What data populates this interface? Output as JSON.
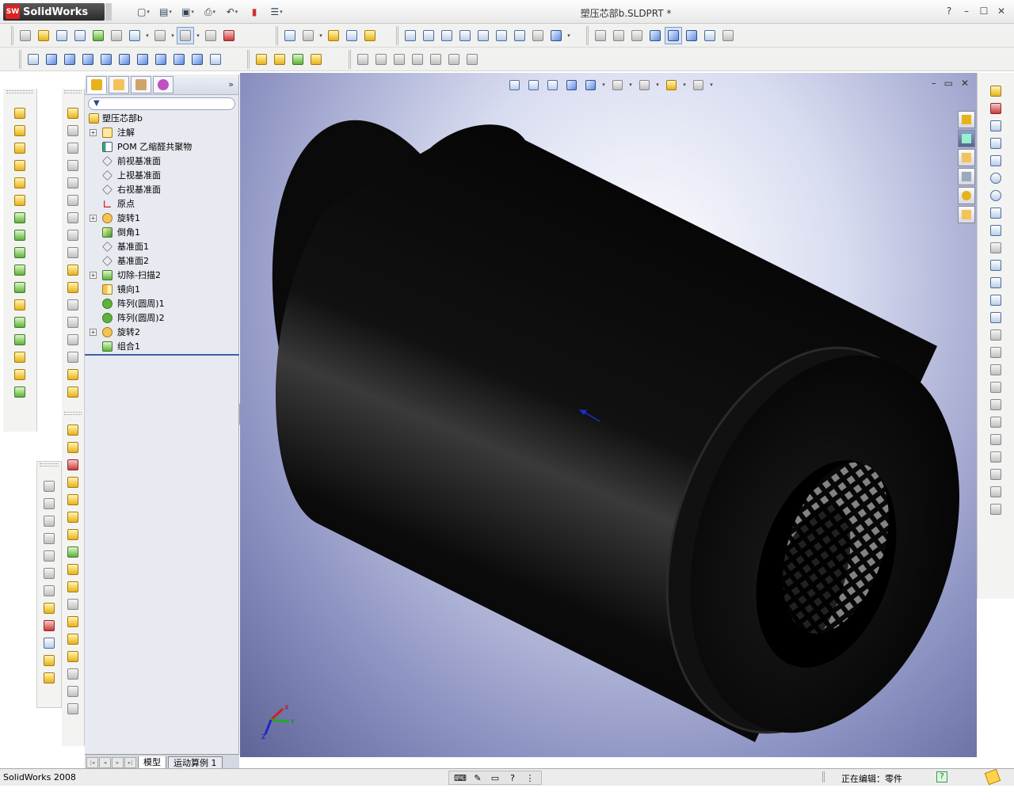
{
  "app": {
    "brand": "SolidWorks",
    "brand_badge": "SW",
    "document_title": "塑压芯部b.SLDPRT *",
    "window_controls": {
      "help": "?",
      "minimize": "–",
      "restore": "☐",
      "close": "✕"
    }
  },
  "feature_tree": {
    "filter_icon": "filter-icon",
    "expand_more": "»",
    "items": [
      {
        "label": "塑压芯部b",
        "icon": "part-icon",
        "expandable": false,
        "root": true
      },
      {
        "label": "注解",
        "icon": "annotations-icon",
        "expandable": true
      },
      {
        "label": "POM 乙缩醛共聚物",
        "icon": "material-icon",
        "expandable": false
      },
      {
        "label": "前视基准面",
        "icon": "plane-icon",
        "expandable": false
      },
      {
        "label": "上视基准面",
        "icon": "plane-icon",
        "expandable": false
      },
      {
        "label": "右视基准面",
        "icon": "plane-icon",
        "expandable": false
      },
      {
        "label": "原点",
        "icon": "origin-icon",
        "expandable": false
      },
      {
        "label": "旋转1",
        "icon": "revolve-icon",
        "expandable": true
      },
      {
        "label": "倒角1",
        "icon": "chamfer-icon",
        "expandable": false
      },
      {
        "label": "基准面1",
        "icon": "plane-icon",
        "expandable": false
      },
      {
        "label": "基准面2",
        "icon": "plane-icon",
        "expandable": false
      },
      {
        "label": "切除-扫描2",
        "icon": "sweep-cut-icon",
        "expandable": true
      },
      {
        "label": "镜向1",
        "icon": "mirror-icon",
        "expandable": false
      },
      {
        "label": "阵列(圆周)1",
        "icon": "circular-pattern-icon",
        "expandable": false
      },
      {
        "label": "阵列(圆周)2",
        "icon": "circular-pattern-icon",
        "expandable": false
      },
      {
        "label": "旋转2",
        "icon": "revolve-icon",
        "expandable": true
      },
      {
        "label": "组合1",
        "icon": "combine-icon",
        "expandable": false
      }
    ],
    "bottom_tabs": [
      "模型",
      "运动算例 1"
    ]
  },
  "viewport": {
    "controls": {
      "minimize": "–",
      "restore": "▭",
      "close": "✕"
    },
    "triad": {
      "x": "X",
      "y": "Y",
      "z": "Z"
    }
  },
  "status_bar": {
    "left_text": "SolidWorks 2008",
    "right_text": "正在编辑：零件",
    "help": "?",
    "mid_help": "?"
  }
}
